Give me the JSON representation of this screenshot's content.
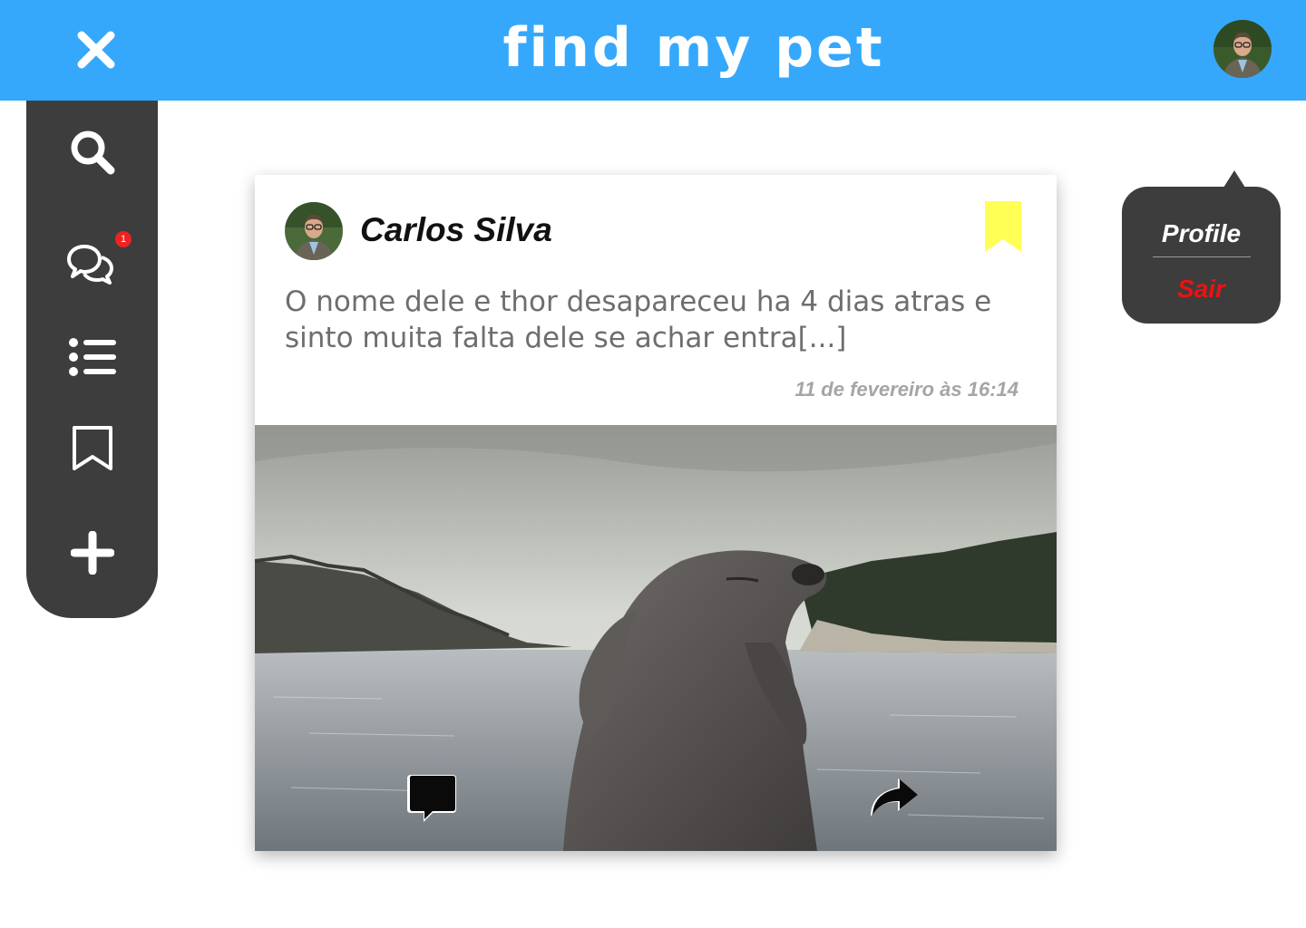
{
  "app": {
    "title": "find my pet",
    "brand_color": "#35a8fb",
    "sidebar_color": "#3d3d3d"
  },
  "header": {
    "close_icon": "close-icon",
    "avatar_icon": "user-avatar"
  },
  "sidebar": {
    "items": [
      {
        "icon": "search-icon"
      },
      {
        "icon": "chat-bubbles-icon",
        "badge": "1"
      },
      {
        "icon": "list-icon"
      },
      {
        "icon": "bookmark-outline-icon"
      },
      {
        "icon": "plus-icon"
      }
    ]
  },
  "post": {
    "author": "Carlos Silva",
    "text": "O nome dele e thor desapareceu ha 4 dias atras e sinto muita falta dele se achar entra[...]",
    "timestamp": "11 de fevereiro às 16:14",
    "bookmark_color": "#ffff55",
    "actions": {
      "comment_icon": "comment-icon",
      "share_icon": "share-icon"
    }
  },
  "user_menu": {
    "profile_label": "Profile",
    "logout_label": "Sair",
    "logout_color": "#ee1111"
  }
}
